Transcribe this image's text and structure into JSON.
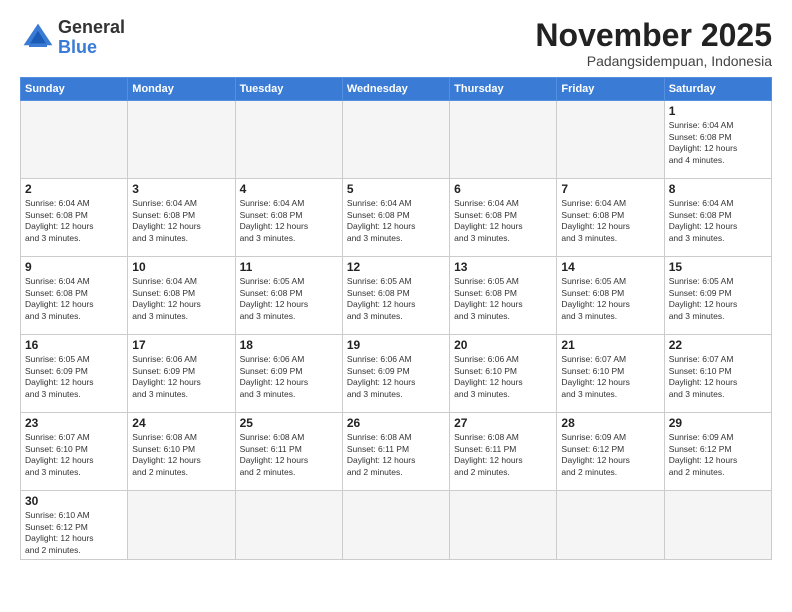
{
  "logo": {
    "text_general": "General",
    "text_blue": "Blue"
  },
  "title": "November 2025",
  "subtitle": "Padangsidempuan, Indonesia",
  "days_of_week": [
    "Sunday",
    "Monday",
    "Tuesday",
    "Wednesday",
    "Thursday",
    "Friday",
    "Saturday"
  ],
  "weeks": [
    {
      "days": [
        {
          "num": "",
          "empty": true
        },
        {
          "num": "",
          "empty": true
        },
        {
          "num": "",
          "empty": true
        },
        {
          "num": "",
          "empty": true
        },
        {
          "num": "",
          "empty": true
        },
        {
          "num": "",
          "empty": true
        },
        {
          "num": "1",
          "info": "Sunrise: 6:04 AM\nSunset: 6:08 PM\nDaylight: 12 hours\nand 4 minutes."
        }
      ]
    },
    {
      "days": [
        {
          "num": "2",
          "info": "Sunrise: 6:04 AM\nSunset: 6:08 PM\nDaylight: 12 hours\nand 3 minutes."
        },
        {
          "num": "3",
          "info": "Sunrise: 6:04 AM\nSunset: 6:08 PM\nDaylight: 12 hours\nand 3 minutes."
        },
        {
          "num": "4",
          "info": "Sunrise: 6:04 AM\nSunset: 6:08 PM\nDaylight: 12 hours\nand 3 minutes."
        },
        {
          "num": "5",
          "info": "Sunrise: 6:04 AM\nSunset: 6:08 PM\nDaylight: 12 hours\nand 3 minutes."
        },
        {
          "num": "6",
          "info": "Sunrise: 6:04 AM\nSunset: 6:08 PM\nDaylight: 12 hours\nand 3 minutes."
        },
        {
          "num": "7",
          "info": "Sunrise: 6:04 AM\nSunset: 6:08 PM\nDaylight: 12 hours\nand 3 minutes."
        },
        {
          "num": "8",
          "info": "Sunrise: 6:04 AM\nSunset: 6:08 PM\nDaylight: 12 hours\nand 3 minutes."
        }
      ]
    },
    {
      "days": [
        {
          "num": "9",
          "info": "Sunrise: 6:04 AM\nSunset: 6:08 PM\nDaylight: 12 hours\nand 3 minutes."
        },
        {
          "num": "10",
          "info": "Sunrise: 6:04 AM\nSunset: 6:08 PM\nDaylight: 12 hours\nand 3 minutes."
        },
        {
          "num": "11",
          "info": "Sunrise: 6:05 AM\nSunset: 6:08 PM\nDaylight: 12 hours\nand 3 minutes."
        },
        {
          "num": "12",
          "info": "Sunrise: 6:05 AM\nSunset: 6:08 PM\nDaylight: 12 hours\nand 3 minutes."
        },
        {
          "num": "13",
          "info": "Sunrise: 6:05 AM\nSunset: 6:08 PM\nDaylight: 12 hours\nand 3 minutes."
        },
        {
          "num": "14",
          "info": "Sunrise: 6:05 AM\nSunset: 6:08 PM\nDaylight: 12 hours\nand 3 minutes."
        },
        {
          "num": "15",
          "info": "Sunrise: 6:05 AM\nSunset: 6:09 PM\nDaylight: 12 hours\nand 3 minutes."
        }
      ]
    },
    {
      "days": [
        {
          "num": "16",
          "info": "Sunrise: 6:05 AM\nSunset: 6:09 PM\nDaylight: 12 hours\nand 3 minutes."
        },
        {
          "num": "17",
          "info": "Sunrise: 6:06 AM\nSunset: 6:09 PM\nDaylight: 12 hours\nand 3 minutes."
        },
        {
          "num": "18",
          "info": "Sunrise: 6:06 AM\nSunset: 6:09 PM\nDaylight: 12 hours\nand 3 minutes."
        },
        {
          "num": "19",
          "info": "Sunrise: 6:06 AM\nSunset: 6:09 PM\nDaylight: 12 hours\nand 3 minutes."
        },
        {
          "num": "20",
          "info": "Sunrise: 6:06 AM\nSunset: 6:10 PM\nDaylight: 12 hours\nand 3 minutes."
        },
        {
          "num": "21",
          "info": "Sunrise: 6:07 AM\nSunset: 6:10 PM\nDaylight: 12 hours\nand 3 minutes."
        },
        {
          "num": "22",
          "info": "Sunrise: 6:07 AM\nSunset: 6:10 PM\nDaylight: 12 hours\nand 3 minutes."
        }
      ]
    },
    {
      "days": [
        {
          "num": "23",
          "info": "Sunrise: 6:07 AM\nSunset: 6:10 PM\nDaylight: 12 hours\nand 3 minutes."
        },
        {
          "num": "24",
          "info": "Sunrise: 6:08 AM\nSunset: 6:10 PM\nDaylight: 12 hours\nand 2 minutes."
        },
        {
          "num": "25",
          "info": "Sunrise: 6:08 AM\nSunset: 6:11 PM\nDaylight: 12 hours\nand 2 minutes."
        },
        {
          "num": "26",
          "info": "Sunrise: 6:08 AM\nSunset: 6:11 PM\nDaylight: 12 hours\nand 2 minutes."
        },
        {
          "num": "27",
          "info": "Sunrise: 6:08 AM\nSunset: 6:11 PM\nDaylight: 12 hours\nand 2 minutes."
        },
        {
          "num": "28",
          "info": "Sunrise: 6:09 AM\nSunset: 6:12 PM\nDaylight: 12 hours\nand 2 minutes."
        },
        {
          "num": "29",
          "info": "Sunrise: 6:09 AM\nSunset: 6:12 PM\nDaylight: 12 hours\nand 2 minutes."
        }
      ]
    },
    {
      "days": [
        {
          "num": "30",
          "info": "Sunrise: 6:10 AM\nSunset: 6:12 PM\nDaylight: 12 hours\nand 2 minutes."
        },
        {
          "num": "",
          "empty": true
        },
        {
          "num": "",
          "empty": true
        },
        {
          "num": "",
          "empty": true
        },
        {
          "num": "",
          "empty": true
        },
        {
          "num": "",
          "empty": true
        },
        {
          "num": "",
          "empty": true
        }
      ]
    }
  ]
}
